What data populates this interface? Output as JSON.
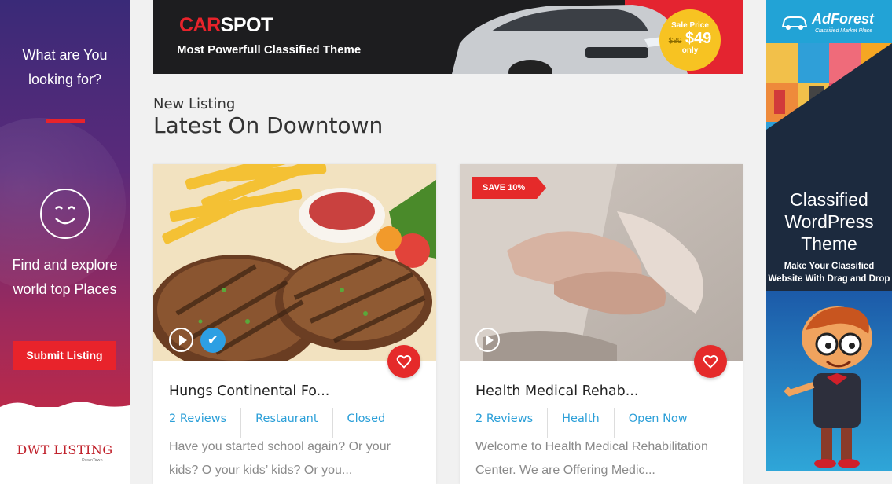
{
  "left_ad": {
    "question": "What are You looking for?",
    "tagline": "Find and explore world top Places",
    "button": "Submit Listing",
    "brand": "DWT LISTING",
    "brand_sub": "DownTown"
  },
  "top_banner": {
    "logo_a": "CAR",
    "logo_b": "SPOT",
    "tagline": "Most Powerfull Classified Theme",
    "sale_label": "Sale Price",
    "old_price": "$89",
    "new_price": "$49",
    "only": "only"
  },
  "right_ad": {
    "brand": "AdForest",
    "brand_sub": "Classified Market Place",
    "heading": "Classified WordPress Theme",
    "desc": "Make Your Classified Website With Drag and Drop"
  },
  "section": {
    "subtitle": "New Listing",
    "title": "Latest On Downtown"
  },
  "listings": [
    {
      "title": "Hungs Continental Fo...",
      "reviews": "2 Reviews",
      "category": "Restaurant",
      "status": "Closed",
      "excerpt": "Have you started school again? Or your kids? O your kids’ kids? Or you..."
    },
    {
      "badge": "SAVE 10%",
      "title": "Health Medical Rehab...",
      "reviews": "2 Reviews",
      "category": "Health",
      "status": "Open Now",
      "excerpt": "Welcome to Health Medical Rehabilitation Center. We are Offering Medic..."
    }
  ],
  "colors": {
    "accent": "#e52a2a",
    "link": "#2b9fd8"
  }
}
